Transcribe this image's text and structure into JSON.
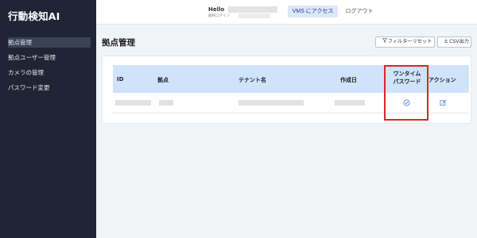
{
  "app": {
    "title": "行動検知AI"
  },
  "sidebar": {
    "items": [
      {
        "label": "拠点管理",
        "active": true
      },
      {
        "label": "拠点ユーザー管理"
      },
      {
        "label": "カメラの管理"
      },
      {
        "label": "パスワード変更"
      }
    ]
  },
  "header": {
    "greeting": "Hello",
    "last_login_label": "最終ログイン",
    "vms_button": "VMS にアクセス",
    "logout_button": "ログアウト"
  },
  "main": {
    "title": "拠点管理",
    "filter_reset_button": "フィルターリセット",
    "csv_button": "CSV出力",
    "table": {
      "columns": [
        "ID",
        "拠点",
        "テナント名",
        "作成日",
        "ワンタイムパスワード",
        "アクション"
      ],
      "otp_header_line1": "ワンタイム",
      "otp_header_line2": "パスワード"
    }
  },
  "colors": {
    "sidebar_bg": "#1f2534",
    "accent_bg": "#dde7fb",
    "table_header_bg": "#cfe3fb",
    "highlight": "#d62828"
  },
  "icons": {
    "filter": "funnel-icon",
    "csv": "download-icon",
    "otp": "check-circle-icon",
    "edit": "edit-icon"
  }
}
